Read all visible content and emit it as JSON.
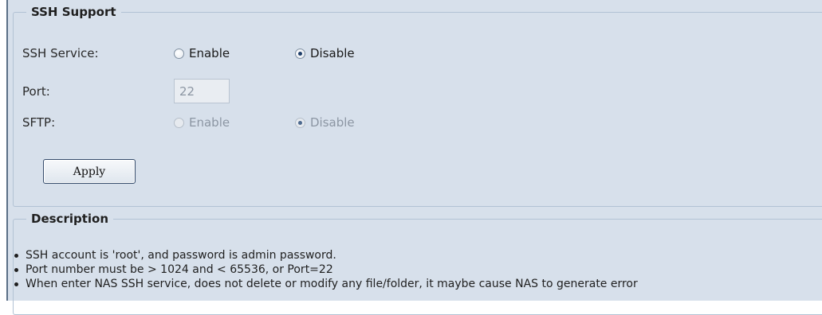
{
  "ssh_support": {
    "legend": "SSH Support",
    "ssh_service": {
      "label": "SSH Service:",
      "options": [
        "Enable",
        "Disable"
      ],
      "selected": "Disable"
    },
    "port": {
      "label": "Port:",
      "value": "22",
      "disabled": true
    },
    "sftp": {
      "label": "SFTP:",
      "options": [
        "Enable",
        "Disable"
      ],
      "selected": "Disable",
      "disabled": true
    },
    "apply_label": "Apply"
  },
  "description": {
    "legend": "Description",
    "items": [
      "SSH account is 'root', and password is admin password.",
      "Port number must be > 1024 and < 65536, or Port=22",
      "When enter NAS SSH service, does not delete or modify any file/folder, it maybe cause NAS to generate error"
    ]
  }
}
